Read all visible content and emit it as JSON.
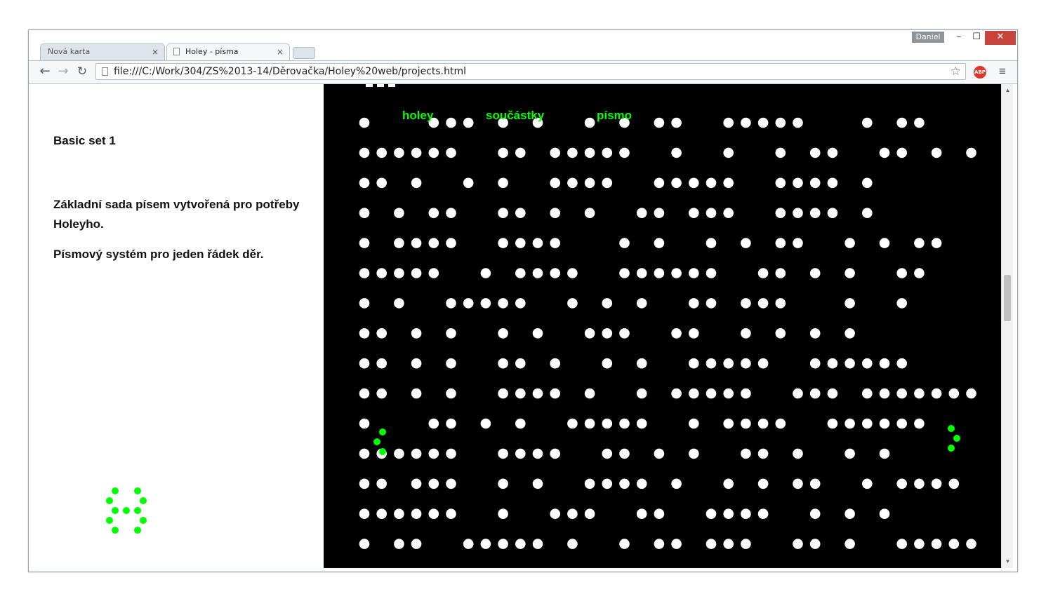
{
  "window": {
    "user_badge": "Daniel",
    "min_label": "–",
    "max_label": "☐",
    "close_label": "✕"
  },
  "tabs": [
    {
      "label": "Nová karta",
      "close": "×"
    },
    {
      "label": "Holey - písma",
      "close": "×"
    }
  ],
  "toolbar": {
    "back": "←",
    "forward": "→",
    "reload": "↻",
    "url": "file:///C:/Work/304/ZS%2013-14/Děrovačka/Holey%20web/projects.html",
    "star": "☆",
    "adblock": "ABP",
    "menu": "≡"
  },
  "page": {
    "heading": "Basic set 1",
    "description": "Základní sada písem vytvořená pro potřeby Holeyho.",
    "subdescription": "Písmový systém pro jeden řádek děr.",
    "nav_links": [
      "holey",
      "součástky",
      "písmo"
    ],
    "colors": {
      "accent": "#00ff00",
      "canvas": "#000000",
      "hole": "#ffffff"
    }
  },
  "hole_grid": {
    "columns": 36,
    "rows": [
      "1...111.1.1..1.1.11..11111...1.11",
      "111111..11.11111..1..1..1.11..11.1.1",
      "11.1..1.1..1111..11111..1111.1",
      "1.1.11..11.1.1..11.111..1111.1",
      "1.1111..1111...1.1..1.1.11..1.1.11",
      "11111..1.1111..111111..11.1.1..11",
      "1.1..11111..1.1.1..11.111...1..1",
      "11.1.1..1.1..111..11..1.1.1.1",
      "11.1.1..11.1..1.1..11111..111111",
      "11.1.1..1111.1..1.11111..111.1111111",
      "1...11.1.1..11111..1.1111..111111",
      "111111..1111..11.1.1..11.1..1.1",
      "11.111..1.1..1111.1..1.1.11..1.1111",
      "111111..1..111..11..1111..1.1.1",
      "1.11..11111.1..1.11.111..11.1..11111"
    ]
  }
}
